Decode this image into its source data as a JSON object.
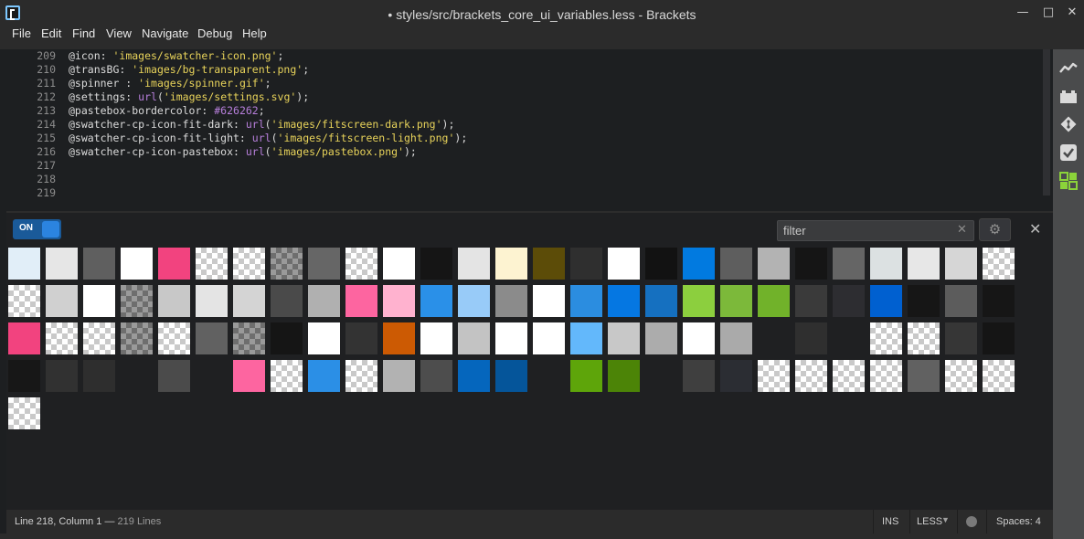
{
  "window": {
    "title": "• styles/src/brackets_core_ui_variables.less - Brackets",
    "minimize_glyph": "—",
    "maximize_glyph": "□",
    "close_glyph": "✕"
  },
  "menu": [
    "File",
    "Edit",
    "Find",
    "View",
    "Navigate",
    "Debug",
    "Help"
  ],
  "editor": {
    "lines": [
      {
        "num": "209",
        "parts": [
          [
            "@icon: ",
            "plain"
          ],
          [
            "'images/swatcher-icon.png'",
            "str"
          ],
          [
            ";",
            "plain"
          ]
        ]
      },
      {
        "num": "210",
        "parts": [
          [
            "@transBG: ",
            "plain"
          ],
          [
            "'images/bg-transparent.png'",
            "str"
          ],
          [
            ";",
            "plain"
          ]
        ]
      },
      {
        "num": "211",
        "parts": [
          [
            "@spinner : ",
            "plain"
          ],
          [
            "'images/spinner.gif'",
            "str"
          ],
          [
            ";",
            "plain"
          ]
        ]
      },
      {
        "num": "212",
        "parts": [
          [
            "@settings: ",
            "plain"
          ],
          [
            "url",
            "fn"
          ],
          [
            "(",
            "plain"
          ],
          [
            "'images/settings.svg'",
            "str"
          ],
          [
            ");",
            "plain"
          ]
        ]
      },
      {
        "num": "213",
        "parts": [
          [
            "@pastebox-bordercolor: ",
            "plain"
          ],
          [
            "#626262",
            "hex"
          ],
          [
            ";",
            "plain"
          ]
        ]
      },
      {
        "num": "214",
        "parts": [
          [
            "@swatcher-cp-icon-fit-dark: ",
            "plain"
          ],
          [
            "url",
            "fn"
          ],
          [
            "(",
            "plain"
          ],
          [
            "'images/fitscreen-dark.png'",
            "str"
          ],
          [
            ");",
            "plain"
          ]
        ]
      },
      {
        "num": "215",
        "parts": [
          [
            "@swatcher-cp-icon-fit-light: ",
            "plain"
          ],
          [
            "url",
            "fn"
          ],
          [
            "(",
            "plain"
          ],
          [
            "'images/fitscreen-light.png'",
            "str"
          ],
          [
            ");",
            "plain"
          ]
        ]
      },
      {
        "num": "216",
        "parts": [
          [
            "@swatcher-cp-icon-pastebox: ",
            "plain"
          ],
          [
            "url",
            "fn"
          ],
          [
            "(",
            "plain"
          ],
          [
            "'images/pastebox.png'",
            "str"
          ],
          [
            ");",
            "plain"
          ]
        ]
      },
      {
        "num": "217",
        "parts": []
      },
      {
        "num": "218",
        "parts": []
      },
      {
        "num": "219",
        "parts": []
      }
    ]
  },
  "swatch_panel": {
    "toggle_label": "ON",
    "filter_placeholder": "filter",
    "filter_clear_glyph": "✕",
    "settings_glyph": "⚙",
    "close_glyph": "✕",
    "rows": [
      [
        "#e1eef8",
        "#e6e6e6",
        "#5f5f5f",
        "#ffffff",
        "#f2437f",
        "checker",
        "checker",
        "checker-dark",
        "#666666",
        "checker",
        "#ffffff",
        "#151515",
        "#e4e4e4",
        "#fdf3d1",
        "#5c4c08",
        "#2f2f2f",
        "#ffffff",
        "#121212",
        "#017ae0",
        "#5e5e5e",
        "#b3b3b3",
        "#151515",
        "#656565",
        "#dce1e2",
        "#e7e7e7",
        "#d6d6d6",
        "checker"
      ],
      [
        "checker",
        "#d0d0d0",
        "#ffffff",
        "checker-dark",
        "#c8c8c8",
        "#e4e4e4",
        "#d4d4d4",
        "#4a4a4a",
        "#b0b0b0",
        "#fd65a0",
        "#ffb2cf",
        "#2a90e8",
        "#98cbf8",
        "#8b8b8b",
        "#ffffff",
        "#2b8de0",
        "#0577e2",
        "#1570c0",
        "#8ccf3e",
        "#7cb93a",
        "#71b22a",
        "#3a3a3a",
        "#2d2d31",
        "#0060d0",
        "#161616",
        "#5c5c5c",
        "#161616"
      ],
      [
        "#f2437f",
        "checker",
        "checker",
        "checker-dark",
        "checker",
        "#616161",
        "checker-dark",
        "#151515",
        "#ffffff",
        "#333333",
        "#cc5a03",
        "#ffffff",
        "#c3c3c3",
        "#ffffff",
        "#ffffff",
        "#63b8fb",
        "#c8c8c8",
        "#acacac",
        "#ffffff",
        "#aaaaaa",
        "none",
        "#2f2f2f",
        "none",
        "checker",
        "checker",
        "#363636",
        "#151515"
      ],
      [
        "#171717",
        "#313131",
        "#2e2e2e",
        "none",
        "#4b4b4b",
        "none",
        "#fd65a0",
        "checker",
        "#2b8fe6",
        "checker",
        "#b2b2b2",
        "#4d4d4d",
        "#0566bd",
        "#05559a",
        "none",
        "#5ea50a",
        "#4c8407",
        "none",
        "#3f3f3f",
        "#2b2d33",
        "checker",
        "checker",
        "checker",
        "checker",
        "#616161",
        "checker",
        "checker"
      ],
      [
        "checker"
      ]
    ]
  },
  "status": {
    "position": "Line 218, Column 1",
    "lines": "219 Lines",
    "ins": "INS",
    "language": "LESS",
    "spaces": "Spaces:  4"
  },
  "sidebar_icons": [
    "live-preview-icon",
    "extension-manager-icon",
    "git-icon",
    "todo-icon",
    "swatcher-icon"
  ],
  "colors": {
    "accent": "#2b84e0",
    "string": "#e8d35a",
    "function": "#b77fdb"
  }
}
